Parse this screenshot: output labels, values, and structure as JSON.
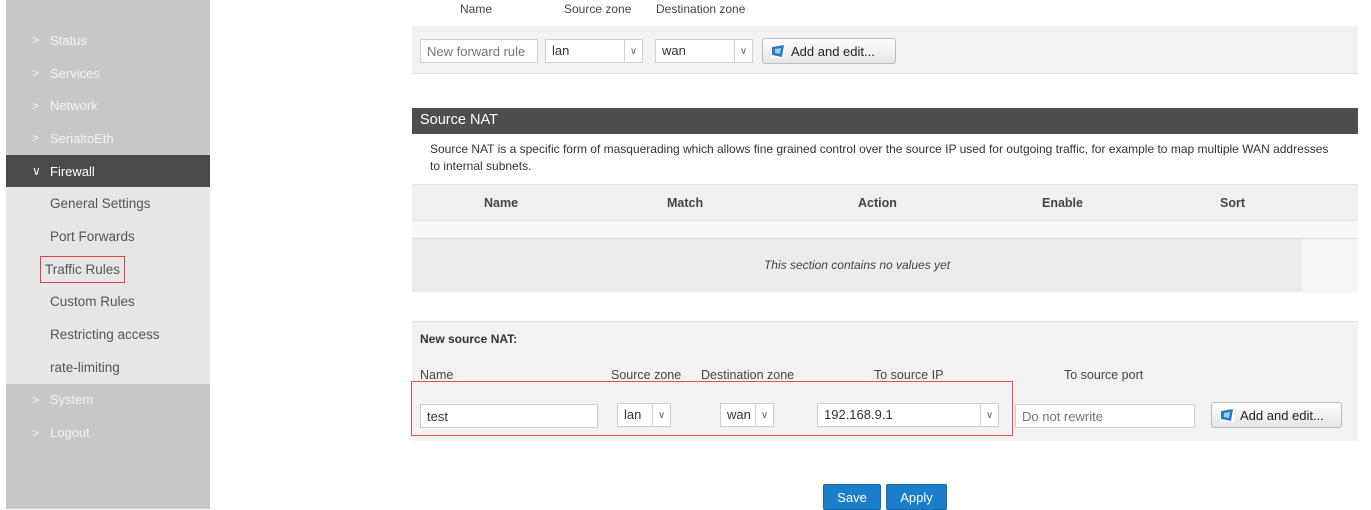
{
  "sidebar": {
    "items": [
      {
        "label": "Status",
        "chev": ">"
      },
      {
        "label": "Services",
        "chev": ">"
      },
      {
        "label": "Network",
        "chev": ">"
      },
      {
        "label": "SerialtoEth",
        "chev": ">"
      }
    ],
    "active": {
      "label": "Firewall",
      "chev": "∨"
    },
    "sub_items": [
      "General Settings",
      "Port Forwards",
      "Traffic Rules",
      "Custom Rules",
      "Restricting access",
      "rate-limiting"
    ],
    "bottom_items": [
      {
        "label": "System",
        "chev": ">"
      },
      {
        "label": "Logout",
        "chev": ">"
      }
    ]
  },
  "forward": {
    "headers": {
      "name": "Name",
      "source_zone": "Source zone",
      "dest_zone": "Destination zone"
    },
    "name_placeholder": "New forward rule",
    "source_zone": "lan",
    "dest_zone": "wan",
    "add_label": "Add and edit..."
  },
  "snat": {
    "title": "Source NAT",
    "description": "Source NAT is a specific form of masquerading which allows fine grained control over the source IP used for outgoing traffic, for example to map multiple WAN addresses to internal subnets.",
    "columns": [
      "Name",
      "Match",
      "Action",
      "Enable",
      "Sort"
    ],
    "empty_msg": "This section contains no values yet"
  },
  "new_snat": {
    "title": "New source NAT:",
    "labels": {
      "name": "Name",
      "source_zone": "Source zone",
      "dest_zone": "Destination zone",
      "to_ip": "To source IP",
      "to_port": "To source port"
    },
    "name_value": "test",
    "source_zone": "lan",
    "dest_zone": "wan",
    "to_ip": "192.168.9.1",
    "port_placeholder": "Do not rewrite",
    "add_label": "Add and edit..."
  },
  "actions": {
    "save": "Save",
    "apply": "Apply"
  }
}
